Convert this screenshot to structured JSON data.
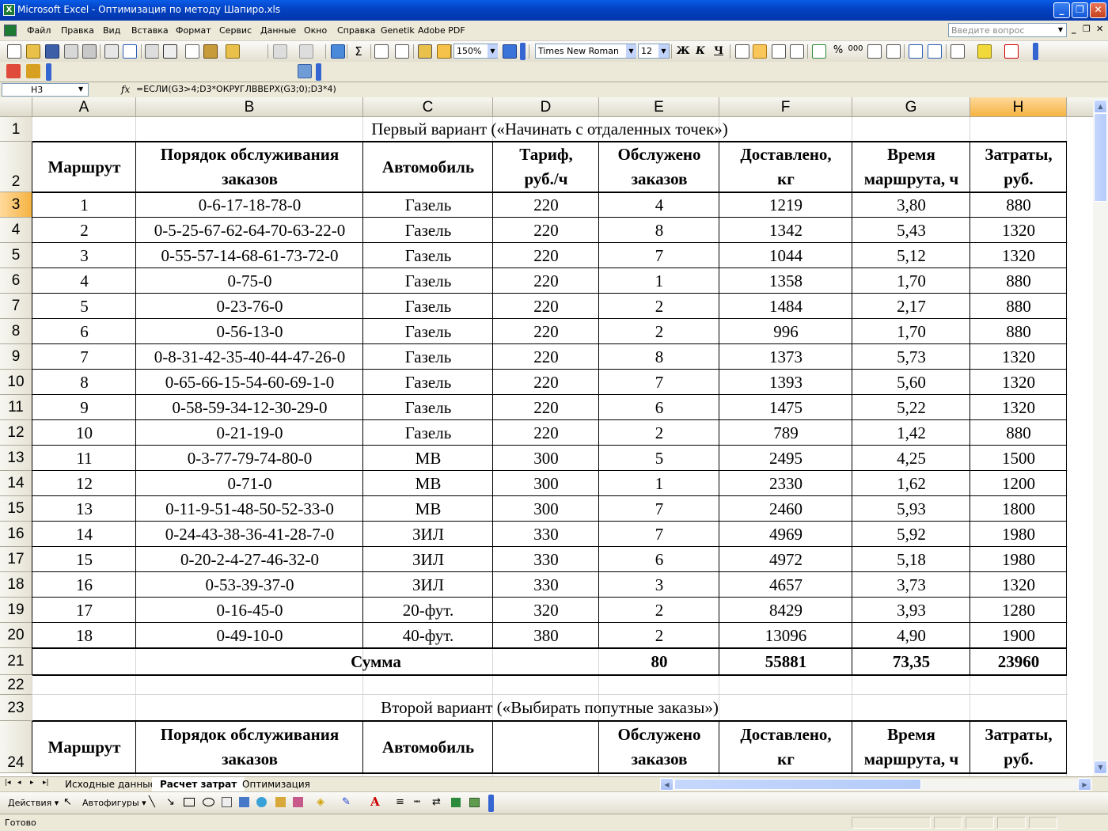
{
  "window": {
    "title": "Microsoft Excel - Оптимизация по методу Шапиро.xls",
    "app_icon": "excel-icon"
  },
  "menu": {
    "items": [
      "Файл",
      "Правка",
      "Вид",
      "Вставка",
      "Формат",
      "Сервис",
      "Данные",
      "Окно",
      "Справка",
      "Genetik",
      "Adobe PDF"
    ],
    "ask_placeholder": "Введите вопрос"
  },
  "toolbar": {
    "zoom": "150%",
    "font_name": "Times New Roman",
    "font_size": "12",
    "bold_label": "Ж",
    "italic_label": "К",
    "underline_label": "Ч",
    "sum_label": "Σ",
    "percent_label": "%",
    "thousands_label": "000"
  },
  "formula_bar": {
    "cell_ref": "H3",
    "fx": "fx",
    "formula": "=ЕСЛИ(G3>4;D3*ОКРУГЛВВЕРХ(G3;0);D3*4)"
  },
  "sheet": {
    "columns": [
      "A",
      "B",
      "C",
      "D",
      "E",
      "F",
      "G",
      "H"
    ],
    "rows": [
      "1",
      "2",
      "3",
      "4",
      "5",
      "6",
      "7",
      "8",
      "9",
      "10",
      "11",
      "12",
      "13",
      "14",
      "15",
      "16",
      "17",
      "18",
      "19",
      "20",
      "21",
      "22",
      "23",
      "24"
    ],
    "title1": "Первый вариант («Начинать с отдаленных точек»)",
    "title2": "Второй вариант («Выбирать попутные заказы»)",
    "headers": [
      [
        "Маршрут"
      ],
      [
        "Порядок обслуживания",
        "заказов"
      ],
      [
        "Автомобиль"
      ],
      [
        "Тариф,",
        "руб./ч"
      ],
      [
        "Обслужено",
        "заказов"
      ],
      [
        "Доставлено,",
        "кг"
      ],
      [
        "Время",
        "маршрута, ч"
      ],
      [
        "Затраты,",
        "руб."
      ]
    ],
    "headers2": [
      [
        "Маршрут"
      ],
      [
        "Порядок обслуживания",
        "заказов"
      ],
      [
        "Автомобиль"
      ],
      [
        ""
      ],
      [
        "Обслужено",
        "заказов"
      ],
      [
        "Доставлено,",
        "кг"
      ],
      [
        "Время",
        "маршрута, ч"
      ],
      [
        "Затраты,",
        "руб."
      ]
    ],
    "data": [
      [
        "1",
        "0-6-17-18-78-0",
        "Газель",
        "220",
        "4",
        "1219",
        "3,80",
        "880"
      ],
      [
        "2",
        "0-5-25-67-62-64-70-63-22-0",
        "Газель",
        "220",
        "8",
        "1342",
        "5,43",
        "1320"
      ],
      [
        "3",
        "0-55-57-14-68-61-73-72-0",
        "Газель",
        "220",
        "7",
        "1044",
        "5,12",
        "1320"
      ],
      [
        "4",
        "0-75-0",
        "Газель",
        "220",
        "1",
        "1358",
        "1,70",
        "880"
      ],
      [
        "5",
        "0-23-76-0",
        "Газель",
        "220",
        "2",
        "1484",
        "2,17",
        "880"
      ],
      [
        "6",
        "0-56-13-0",
        "Газель",
        "220",
        "2",
        "996",
        "1,70",
        "880"
      ],
      [
        "7",
        "0-8-31-42-35-40-44-47-26-0",
        "Газель",
        "220",
        "8",
        "1373",
        "5,73",
        "1320"
      ],
      [
        "8",
        "0-65-66-15-54-60-69-1-0",
        "Газель",
        "220",
        "7",
        "1393",
        "5,60",
        "1320"
      ],
      [
        "9",
        "0-58-59-34-12-30-29-0",
        "Газель",
        "220",
        "6",
        "1475",
        "5,22",
        "1320"
      ],
      [
        "10",
        "0-21-19-0",
        "Газель",
        "220",
        "2",
        "789",
        "1,42",
        "880"
      ],
      [
        "11",
        "0-3-77-79-74-80-0",
        "МВ",
        "300",
        "5",
        "2495",
        "4,25",
        "1500"
      ],
      [
        "12",
        "0-71-0",
        "МВ",
        "300",
        "1",
        "2330",
        "1,62",
        "1200"
      ],
      [
        "13",
        "0-11-9-51-48-50-52-33-0",
        "МВ",
        "300",
        "7",
        "2460",
        "5,93",
        "1800"
      ],
      [
        "14",
        "0-24-43-38-36-41-28-7-0",
        "ЗИЛ",
        "330",
        "7",
        "4969",
        "5,92",
        "1980"
      ],
      [
        "15",
        "0-20-2-4-27-46-32-0",
        "ЗИЛ",
        "330",
        "6",
        "4972",
        "5,18",
        "1980"
      ],
      [
        "16",
        "0-53-39-37-0",
        "ЗИЛ",
        "330",
        "3",
        "4657",
        "3,73",
        "1320"
      ],
      [
        "17",
        "0-16-45-0",
        "20-фут.",
        "320",
        "2",
        "8429",
        "3,93",
        "1280"
      ],
      [
        "18",
        "0-49-10-0",
        "40-фут.",
        "380",
        "2",
        "13096",
        "4,90",
        "1900"
      ]
    ],
    "sum": {
      "label": "Сумма",
      "orders": "80",
      "delivered": "55881",
      "time": "73,35",
      "cost": "23960"
    }
  },
  "tabs": {
    "nav": [
      "|◂",
      "◂",
      "▸",
      "▸|"
    ],
    "items": [
      "Исходные данные",
      "Расчет затрат",
      "Оптимизация"
    ],
    "active_index": 1
  },
  "drawing": {
    "actions_label": "Действия ▾",
    "autoshapes_label": "Автофигуры ▾"
  },
  "status": {
    "text": "Готово"
  }
}
